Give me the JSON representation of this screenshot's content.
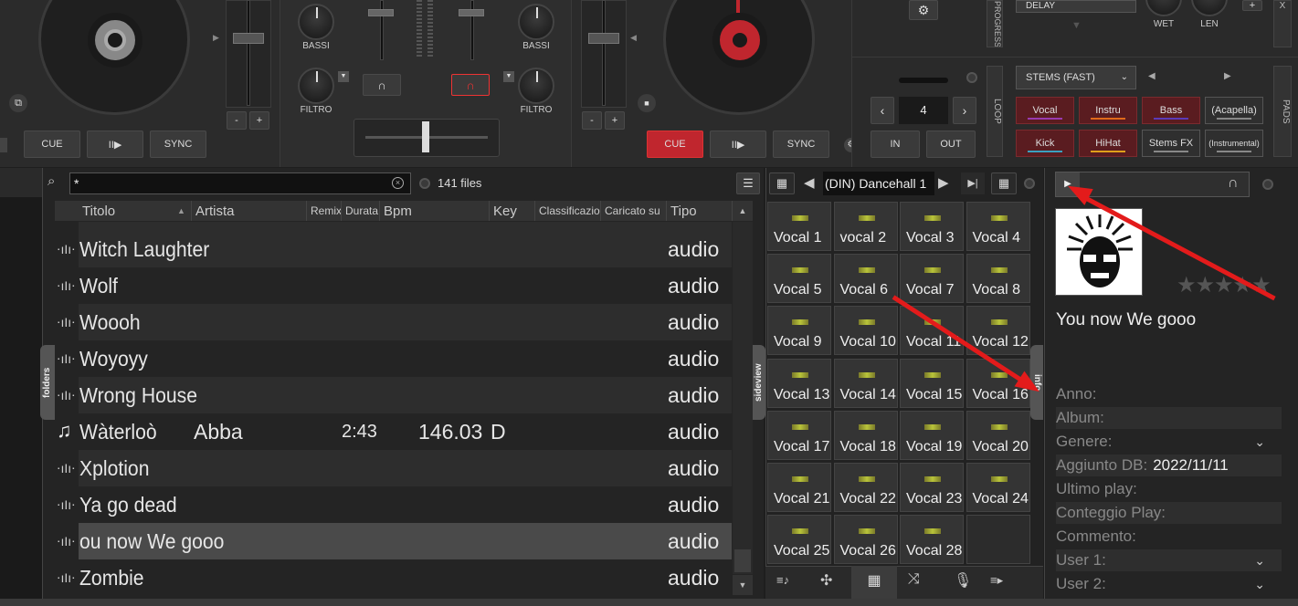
{
  "deck_left": {
    "cue": "CUE",
    "play": "II▶",
    "sync": "SYNC"
  },
  "deck_right": {
    "cue": "CUE",
    "play": "II▶",
    "sync": "SYNC"
  },
  "mixer": {
    "bassi_l": "BASSI",
    "filtro_l": "FILTRO",
    "bassi_r": "BASSI",
    "filtro_r": "FILTRO"
  },
  "pitch": {
    "minus": "-",
    "plus": "+"
  },
  "effects": {
    "delay": "DELAY",
    "wet": "WET",
    "len": "LEN",
    "stems_mode": "STEMS (FAST)",
    "progress": "PROGRESS",
    "loop": "LOOP",
    "pads": "PADS",
    "loop_value": "4",
    "in": "IN",
    "out": "OUT",
    "plus": "+",
    "x": "X"
  },
  "stems": [
    {
      "label": "Vocal",
      "color": "#9a3ab0",
      "red": true
    },
    {
      "label": "Instru",
      "color": "#e06a1a",
      "red": true
    },
    {
      "label": "Bass",
      "color": "#5b3ab8",
      "red": true
    },
    {
      "label": "(Acapella)",
      "color": "#888888",
      "red": false
    },
    {
      "label": "Kick",
      "color": "#3aa0c0",
      "red": true
    },
    {
      "label": "HiHat",
      "color": "#e0a01a",
      "red": true
    },
    {
      "label": "Stems FX",
      "color": "#888888",
      "red": false
    },
    {
      "label": "(Instrumental)",
      "color": "#888888",
      "red": false
    }
  ],
  "browser": {
    "search_value": "*",
    "file_count": "141 files",
    "columns": [
      "Titolo",
      "Artista",
      "Remix",
      "Durata",
      "Bpm",
      "Key",
      "Classificazione",
      "Caricato su",
      "Tipo"
    ],
    "rows": [
      {
        "title": "Witch Laughter",
        "artist": "",
        "duration": "",
        "bpm": "",
        "key": "",
        "type": "audio",
        "icon": "waveform"
      },
      {
        "title": "Wolf",
        "artist": "",
        "duration": "",
        "bpm": "",
        "key": "",
        "type": "audio",
        "icon": "waveform"
      },
      {
        "title": "Woooh",
        "artist": "",
        "duration": "",
        "bpm": "",
        "key": "",
        "type": "audio",
        "icon": "waveform"
      },
      {
        "title": "Woyoyy",
        "artist": "",
        "duration": "",
        "bpm": "",
        "key": "",
        "type": "audio",
        "icon": "waveform"
      },
      {
        "title": "Wrong House",
        "artist": "",
        "duration": "",
        "bpm": "",
        "key": "",
        "type": "audio",
        "icon": "waveform"
      },
      {
        "title": "Wàterloò",
        "artist": "Abba",
        "duration": "2:43",
        "bpm": "146.03",
        "key": "D",
        "type": "audio",
        "icon": "music-note"
      },
      {
        "title": "Xplotion",
        "artist": "",
        "duration": "",
        "bpm": "",
        "key": "",
        "type": "audio",
        "icon": "waveform"
      },
      {
        "title": "Ya go dead",
        "artist": "",
        "duration": "",
        "bpm": "",
        "key": "",
        "type": "audio",
        "icon": "waveform"
      },
      {
        "title": "ou now We gooo",
        "artist": "",
        "duration": "",
        "bpm": "",
        "key": "",
        "type": "audio",
        "icon": "waveform"
      },
      {
        "title": "Zombie",
        "artist": "",
        "duration": "",
        "bpm": "",
        "key": "",
        "type": "audio",
        "icon": "waveform"
      }
    ],
    "folders_tab": "folders",
    "sideview_tab": "sideview"
  },
  "sampler": {
    "bank": "(DIN) Dancehall 1",
    "pads": [
      "Vocal 1",
      "vocal 2",
      "Vocal 3",
      "Vocal 4",
      "Vocal 5",
      "Vocal 6",
      "Vocal 7",
      "Vocal 8",
      "Vocal 9",
      "Vocal 10",
      "Vocal 11",
      "Vocal 12",
      "Vocal 13",
      "Vocal 14",
      "Vocal 15",
      "Vocal 16",
      "Vocal 17",
      "Vocal 18",
      "Vocal 19",
      "Vocal 20",
      "Vocal 21",
      "Vocal 22",
      "Vocal 23",
      "Vocal 24",
      "Vocal 25",
      "Vocal 26",
      "Vocal 28",
      ""
    ]
  },
  "info": {
    "tab": "info",
    "track_title": "You now We gooo",
    "fields": [
      {
        "label": "Anno:",
        "value": "",
        "dropdown": false
      },
      {
        "label": "Album:",
        "value": "",
        "dropdown": false
      },
      {
        "label": "Genere:",
        "value": "",
        "dropdown": true
      },
      {
        "label": "Aggiunto DB:",
        "value": "2022/11/11",
        "dropdown": false
      },
      {
        "label": "Ultimo play:",
        "value": "",
        "dropdown": false
      },
      {
        "label": "Conteggio Play:",
        "value": "",
        "dropdown": false
      },
      {
        "label": "Commento:",
        "value": "",
        "dropdown": false
      },
      {
        "label": "User 1:",
        "value": "",
        "dropdown": true
      },
      {
        "label": "User 2:",
        "value": "",
        "dropdown": true
      }
    ]
  }
}
